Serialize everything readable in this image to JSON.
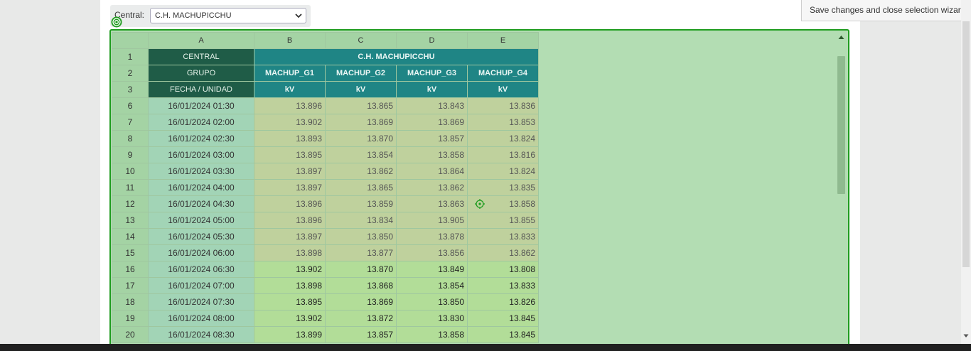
{
  "central": {
    "label": "Central:",
    "selected": "C.H. MACHUPICCHU"
  },
  "tooltip": "Save changes and close selection wizard.",
  "grid": {
    "column_letters": [
      "A",
      "B",
      "C",
      "D",
      "E"
    ],
    "header_rows": [
      {
        "row": "1",
        "label": "CENTRAL",
        "merged": "C.H. MACHUPICCHU"
      },
      {
        "row": "2",
        "label": "GRUPO",
        "cells": [
          "MACHUP_G1",
          "MACHUP_G2",
          "MACHUP_G3",
          "MACHUP_G4"
        ]
      },
      {
        "row": "3",
        "label": "FECHA / UNIDAD",
        "cells": [
          "kV",
          "kV",
          "kV",
          "kV"
        ]
      }
    ],
    "rows": [
      {
        "row": "6",
        "date": "16/01/2024 01:30",
        "values": [
          "13.896",
          "13.865",
          "13.843",
          "13.836"
        ],
        "highlighted": true
      },
      {
        "row": "7",
        "date": "16/01/2024 02:00",
        "values": [
          "13.902",
          "13.869",
          "13.869",
          "13.853"
        ],
        "highlighted": true
      },
      {
        "row": "8",
        "date": "16/01/2024 02:30",
        "values": [
          "13.893",
          "13.870",
          "13.857",
          "13.824"
        ],
        "highlighted": true
      },
      {
        "row": "9",
        "date": "16/01/2024 03:00",
        "values": [
          "13.895",
          "13.854",
          "13.858",
          "13.816"
        ],
        "highlighted": true
      },
      {
        "row": "10",
        "date": "16/01/2024 03:30",
        "values": [
          "13.897",
          "13.862",
          "13.864",
          "13.824"
        ],
        "highlighted": true
      },
      {
        "row": "11",
        "date": "16/01/2024 04:00",
        "values": [
          "13.897",
          "13.865",
          "13.862",
          "13.835"
        ],
        "highlighted": true
      },
      {
        "row": "12",
        "date": "16/01/2024 04:30",
        "values": [
          "13.896",
          "13.859",
          "13.863",
          "13.858"
        ],
        "highlighted": true
      },
      {
        "row": "13",
        "date": "16/01/2024 05:00",
        "values": [
          "13.896",
          "13.834",
          "13.905",
          "13.855"
        ],
        "highlighted": true
      },
      {
        "row": "14",
        "date": "16/01/2024 05:30",
        "values": [
          "13.897",
          "13.850",
          "13.878",
          "13.833"
        ],
        "highlighted": true
      },
      {
        "row": "15",
        "date": "16/01/2024 06:00",
        "values": [
          "13.898",
          "13.877",
          "13.856",
          "13.862"
        ],
        "highlighted": true
      },
      {
        "row": "16",
        "date": "16/01/2024 06:30",
        "values": [
          "13.902",
          "13.870",
          "13.849",
          "13.808"
        ],
        "highlighted": false
      },
      {
        "row": "17",
        "date": "16/01/2024 07:00",
        "values": [
          "13.898",
          "13.868",
          "13.854",
          "13.833"
        ],
        "highlighted": false
      },
      {
        "row": "18",
        "date": "16/01/2024 07:30",
        "values": [
          "13.895",
          "13.869",
          "13.850",
          "13.826"
        ],
        "highlighted": false
      },
      {
        "row": "19",
        "date": "16/01/2024 08:00",
        "values": [
          "13.902",
          "13.872",
          "13.830",
          "13.845"
        ],
        "highlighted": false
      },
      {
        "row": "20",
        "date": "16/01/2024 08:30",
        "values": [
          "13.899",
          "13.857",
          "13.858",
          "13.845"
        ],
        "highlighted": false
      }
    ]
  },
  "icons": {
    "select_target": "target-icon",
    "cell_target": "crosshair-icon",
    "dropdown": "chevron-down-icon"
  },
  "colors": {
    "selection_border": "#1f9c1f",
    "selection_fill": "#b3ddb3",
    "header_dark": "#1f5c47",
    "header_teal": "#1f8585"
  }
}
